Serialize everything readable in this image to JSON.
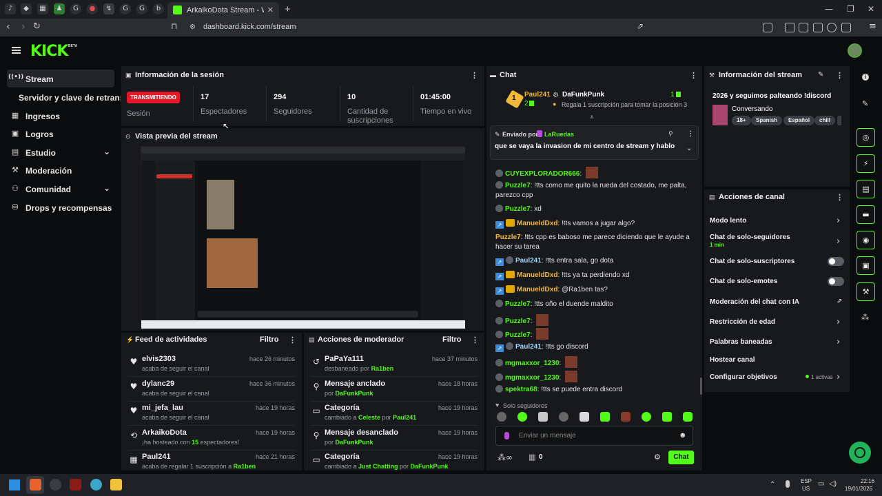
{
  "browser": {
    "active_tab_title": "ArkaikoDota Stream - Watch Live",
    "tab_close": "✕",
    "new_tab": "+",
    "url": "dashboard.kick.com/stream",
    "window_controls": [
      "—",
      "❐",
      "✕"
    ]
  },
  "kick": {
    "logo": "KICK",
    "logo_badge": "BETA"
  },
  "sidebar": {
    "items": [
      {
        "label": "Stream",
        "icon": "broadcast-icon",
        "glyph": "((•))"
      },
      {
        "label": "Servidor y clave de retransmisión",
        "icon": "none",
        "glyph": ""
      },
      {
        "label": "Ingresos",
        "icon": "revenue-icon",
        "glyph": "▦"
      },
      {
        "label": "Logros",
        "icon": "achievements-icon",
        "glyph": "▣"
      },
      {
        "label": "Estudio",
        "icon": "studio-icon",
        "glyph": "▤"
      },
      {
        "label": "Moderación",
        "icon": "moderation-icon",
        "glyph": "⚒"
      },
      {
        "label": "Comunidad",
        "icon": "community-icon",
        "glyph": "⚇"
      },
      {
        "label": "Drops y recompensas",
        "icon": "drops-icon",
        "glyph": "⛁"
      }
    ]
  },
  "session": {
    "title": "Información de la sesión",
    "live_badge": "TRANSMITIENDO",
    "live_label": "Sesión",
    "stats": [
      {
        "value": "17",
        "label": "Espectadores"
      },
      {
        "value": "294",
        "label": "Seguidores"
      },
      {
        "value": "10",
        "label": "Cantidad de suscripciones"
      },
      {
        "value": "01:45:00",
        "label": "Tiempo en vivo"
      }
    ]
  },
  "preview": {
    "title": "Vista previa del stream"
  },
  "feed": {
    "title": "Feed de actividades",
    "filter": "Filtro",
    "items": [
      {
        "icon": "heart-icon",
        "glyph": "♥",
        "name": "elvis2303",
        "sub_pre": "acaba de seguir el canal",
        "time": "hace 26 minutos"
      },
      {
        "icon": "heart-icon",
        "glyph": "♥",
        "name": "dylanc29",
        "sub_pre": "acaba de seguir el canal",
        "time": "hace 36 minutos"
      },
      {
        "icon": "heart-icon",
        "glyph": "♥",
        "name": "mi_jefa_lau",
        "sub_pre": "acaba de seguir el canal",
        "time": "hace 19 horas"
      },
      {
        "icon": "host-icon",
        "glyph": "⟲",
        "name": "ArkaikoDota",
        "sub_pre": "¡ha hosteado con ",
        "sub_hl": "15",
        "sub_post": " espectadores!",
        "time": "hace 19 horas"
      },
      {
        "icon": "gift-icon",
        "glyph": "▦",
        "name": "Paul241",
        "sub_pre": "acaba de regalar 1 suscripción a ",
        "sub_hl": "Ra1ben",
        "time": "hace 21 horas"
      }
    ]
  },
  "modactions": {
    "title": "Acciones de moderador",
    "filter": "Filtro",
    "items": [
      {
        "icon": "unban-icon",
        "glyph": "↺",
        "name": "PaPaYa111",
        "sub_pre": "desbaneado por ",
        "sub_hl": "Ra1ben",
        "time": "hace 37 minutos"
      },
      {
        "icon": "pin-icon",
        "glyph": "⚲",
        "name": "Mensaje anclado",
        "sub_pre": "por ",
        "sub_hl": "DaFunkPunk",
        "time": "hace 18 horas"
      },
      {
        "icon": "category-icon",
        "glyph": "▭",
        "name": "Categoría",
        "sub_pre": "cambiado a ",
        "sub_hl": "Celeste",
        "sub_mid": " por ",
        "sub_hl2": "Paul241",
        "time": "hace 19 horas"
      },
      {
        "icon": "unpin-icon",
        "glyph": "⚲",
        "name": "Mensaje desanclado",
        "sub_pre": "por ",
        "sub_hl": "DaFunkPunk",
        "time": "hace 19 horas"
      },
      {
        "icon": "category-icon",
        "glyph": "▭",
        "name": "Categoría",
        "sub_pre": "cambiado a ",
        "sub_hl": "Just Chatting",
        "sub_mid": " por ",
        "sub_hl2": "DaFunkPunk",
        "time": "hace 19 horas"
      }
    ]
  },
  "chat": {
    "title": "Chat",
    "leaderboard": {
      "rank": "1",
      "name1": "Paul241",
      "count1": "2",
      "name2": "DaFunkPunk",
      "count2": "1",
      "gift_text": "Regala 1 suscripción para tomar la posición 3"
    },
    "pinned": {
      "by_label": "Enviado por",
      "by_user": "LaRuedas",
      "text": "que se vaya la invasion de mi centro de stream y hablo"
    },
    "messages": [
      {
        "user": "CUYEXPLORADOR666",
        "color": "#53fc18",
        "text": "",
        "badges": "b",
        "emote": true
      },
      {
        "user": "Puzzle7",
        "color": "#53fc18",
        "text": "!tts como me quito la rueda del costado, me palta, parezco cpp",
        "badges": "b"
      },
      {
        "user": "Puzzle7",
        "color": "#53fc18",
        "text": "xd",
        "badges": "b"
      },
      {
        "user": "ManueldDxd",
        "color": "#f0b93a",
        "text": "!tts vamos a jugar algo?",
        "badges": "vc"
      },
      {
        "user": "Puzzle7",
        "color": "#f0b93a",
        "text": "!tts cpp es baboso me parece diciendo que le ayude a hacer su tarea",
        "badges": ""
      },
      {
        "user": "Paul241",
        "color": "#9fd8ff",
        "text": "!tts entra sala, go dota",
        "badges": "vb"
      },
      {
        "user": "ManueldDxd",
        "color": "#f0b93a",
        "text": "!tts ya ta perdiendo xd",
        "badges": "vc"
      },
      {
        "user": "ManueldDxd",
        "color": "#f0b93a",
        "text": "@Ra1ben tas?",
        "badges": "vc"
      },
      {
        "user": "Puzzle7",
        "color": "#53fc18",
        "text": "!tts oño el duende maldito",
        "badges": "b"
      },
      {
        "user": "Puzzle7",
        "color": "#53fc18",
        "text": "",
        "badges": "b",
        "emote": true
      },
      {
        "user": "Puzzle7",
        "color": "#53fc18",
        "text": "",
        "badges": "b",
        "emote": true
      },
      {
        "user": "Paul241",
        "color": "#9fd8ff",
        "text": "!tts go discord",
        "badges": "vb"
      },
      {
        "user": "mgmaxxor_1230",
        "color": "#53fc18",
        "text": "",
        "badges": "b",
        "emote": true
      },
      {
        "user": "mgmaxxor_1230",
        "color": "#53fc18",
        "text": "",
        "badges": "b",
        "emote": true
      },
      {
        "user": "spektra68",
        "color": "#53fc18",
        "text": "!tts se puede entra discord",
        "badges": "b"
      }
    ],
    "followers_only": "Solo seguidores",
    "input_placeholder": "Enviar un mensaje",
    "points": "0",
    "send": "Chat"
  },
  "streaminfo": {
    "title": "Información del stream",
    "stream_title": "2026 y seguimos palteando !discord",
    "category": "Conversando",
    "tags": [
      "18+",
      "Spanish",
      "Español",
      "chill"
    ]
  },
  "channel_actions": {
    "title": "Acciones de canal",
    "items": [
      {
        "label": "Modo lento",
        "type": "arrow"
      },
      {
        "label": "Chat de solo-seguidores",
        "sub": "1 min",
        "type": "arrow"
      },
      {
        "label": "Chat de solo-suscriptores",
        "type": "toggle"
      },
      {
        "label": "Chat de solo-emotes",
        "type": "toggle"
      },
      {
        "label": "Moderación del chat con IA",
        "type": "external"
      },
      {
        "label": "Restricción de edad",
        "type": "arrow"
      },
      {
        "label": "Palabras baneadas",
        "type": "arrow"
      },
      {
        "label": "Hostear canal",
        "type": "none"
      },
      {
        "label": "Configurar objetivos",
        "extra": "1 activas",
        "type": "arrow"
      }
    ]
  },
  "taskbar": {
    "lang1": "ESP",
    "lang2": "US",
    "time": "22:16",
    "date": "19/01/2026"
  },
  "colors": {
    "accent": "#53fc18",
    "live": "#e5182b",
    "panel": "#18191d",
    "background": "#0b0c0e"
  }
}
